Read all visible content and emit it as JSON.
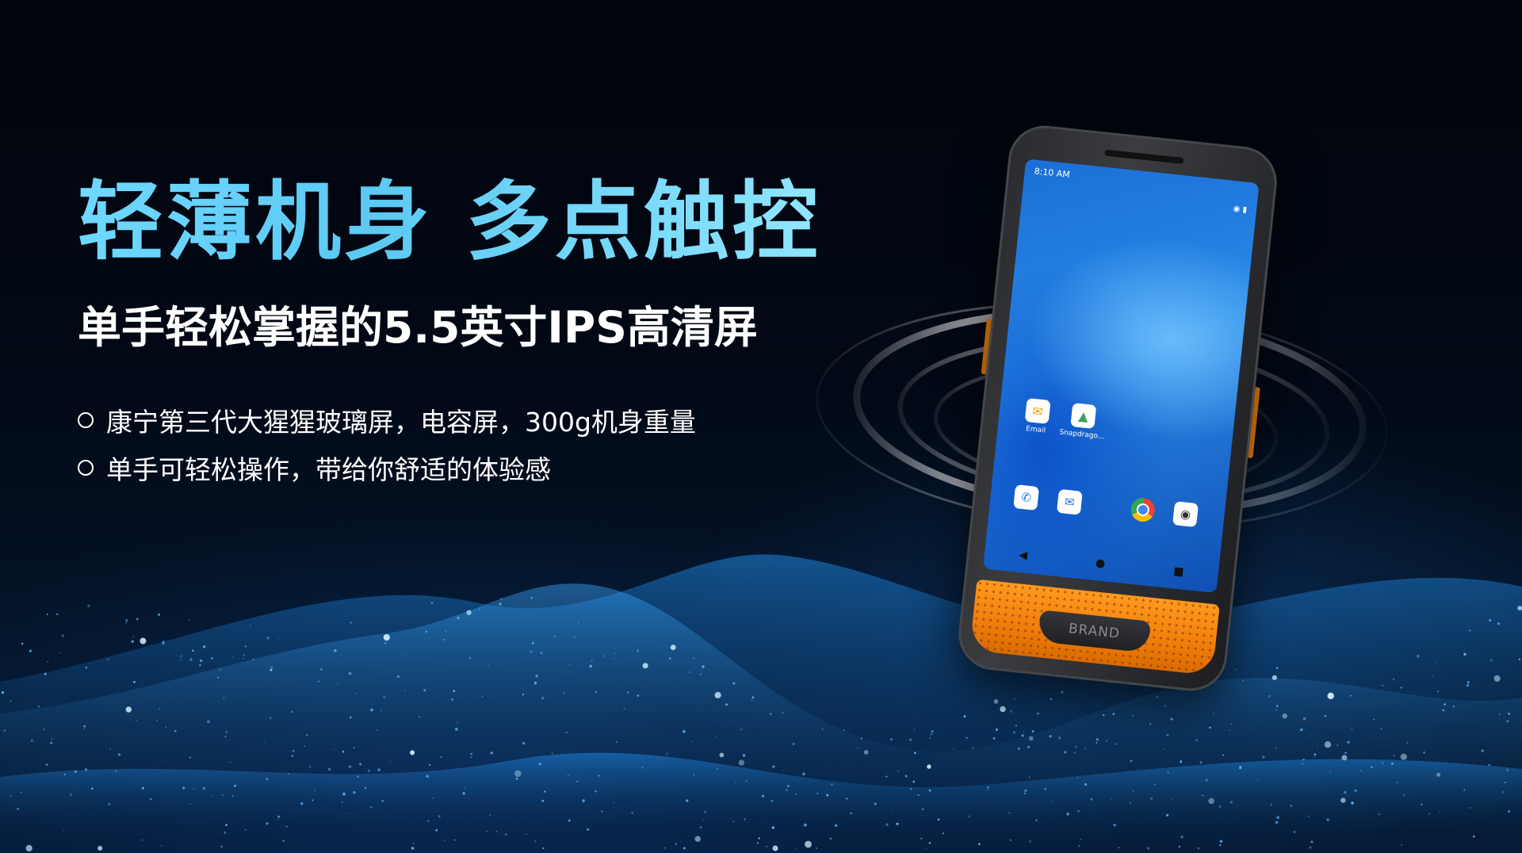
{
  "headline": "轻薄机身 多点触控",
  "subhead": "单手轻松掌握的5.5英寸IPS高清屏",
  "features": [
    "康宁第三代大猩猩玻璃屏，电容屏，300g机身重量",
    "单手可轻松操作，带给你舒适的体验感"
  ],
  "phone": {
    "status_time": "8:10 AM",
    "apps": [
      {
        "label": "Email",
        "icon": "mail-icon"
      },
      {
        "label": "Snapdrago...",
        "icon": "gallery-icon"
      }
    ],
    "dock": [
      "phone-icon",
      "messages-icon",
      "chrome-icon",
      "camera-icon"
    ],
    "brand": "BRAND"
  },
  "colors": {
    "headline_gradient_start": "#6fd8ff",
    "headline_gradient_end": "#8fe6ff",
    "accent_orange": "#f07d0a",
    "background_dark": "#02060f",
    "wave_blue": "#2f9dff"
  }
}
